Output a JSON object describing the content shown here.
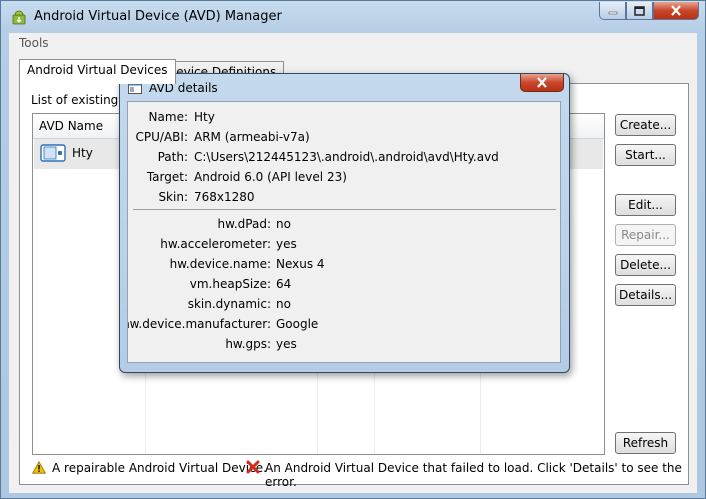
{
  "window": {
    "title": "Android Virtual Device (AVD) Manager"
  },
  "menu": {
    "tools": "Tools"
  },
  "tabs": [
    {
      "label": "Android Virtual Devices",
      "active": true
    },
    {
      "label": "Device Definitions",
      "active": false
    }
  ],
  "panel": {
    "list_label": "List of existing Ar"
  },
  "table": {
    "header_name": "AVD Name",
    "rows": [
      {
        "name": "Hty"
      }
    ]
  },
  "buttons": {
    "create": "Create...",
    "start": "Start...",
    "edit": "Edit...",
    "repair": "Repair...",
    "delete": "Delete...",
    "details": "Details...",
    "refresh": "Refresh"
  },
  "legend": {
    "repairable": "A repairable Android Virtual Device.",
    "failed": "An Android Virtual Device that failed to load. Click 'Details' to see the error."
  },
  "dialog": {
    "title": "AVD details",
    "top_fields": [
      {
        "key": "Name:",
        "value": "Hty"
      },
      {
        "key": "CPU/ABI:",
        "value": "ARM (armeabi-v7a)"
      },
      {
        "key": "Path:",
        "value": "C:\\Users\\212445123\\.android\\.android\\avd\\Hty.avd"
      },
      {
        "key": "Target:",
        "value": "Android 6.0 (API level 23)"
      },
      {
        "key": "Skin:",
        "value": "768x1280"
      }
    ],
    "properties": [
      {
        "key": "hw.dPad:",
        "value": "no"
      },
      {
        "key": "hw.accelerometer:",
        "value": "yes"
      },
      {
        "key": "hw.device.name:",
        "value": "Nexus 4"
      },
      {
        "key": "vm.heapSize:",
        "value": "64"
      },
      {
        "key": "skin.dynamic:",
        "value": "no"
      },
      {
        "key": "hw.device.manufacturer:",
        "value": "Google"
      },
      {
        "key": "hw.gps:",
        "value": "yes"
      }
    ]
  },
  "colors": {
    "title_gradient_top": "#c8dcee",
    "close_red": "#c8462b",
    "row_selected": "#e8e8e8",
    "warning_yellow": "#f2c200",
    "error_red": "#d9281c"
  }
}
